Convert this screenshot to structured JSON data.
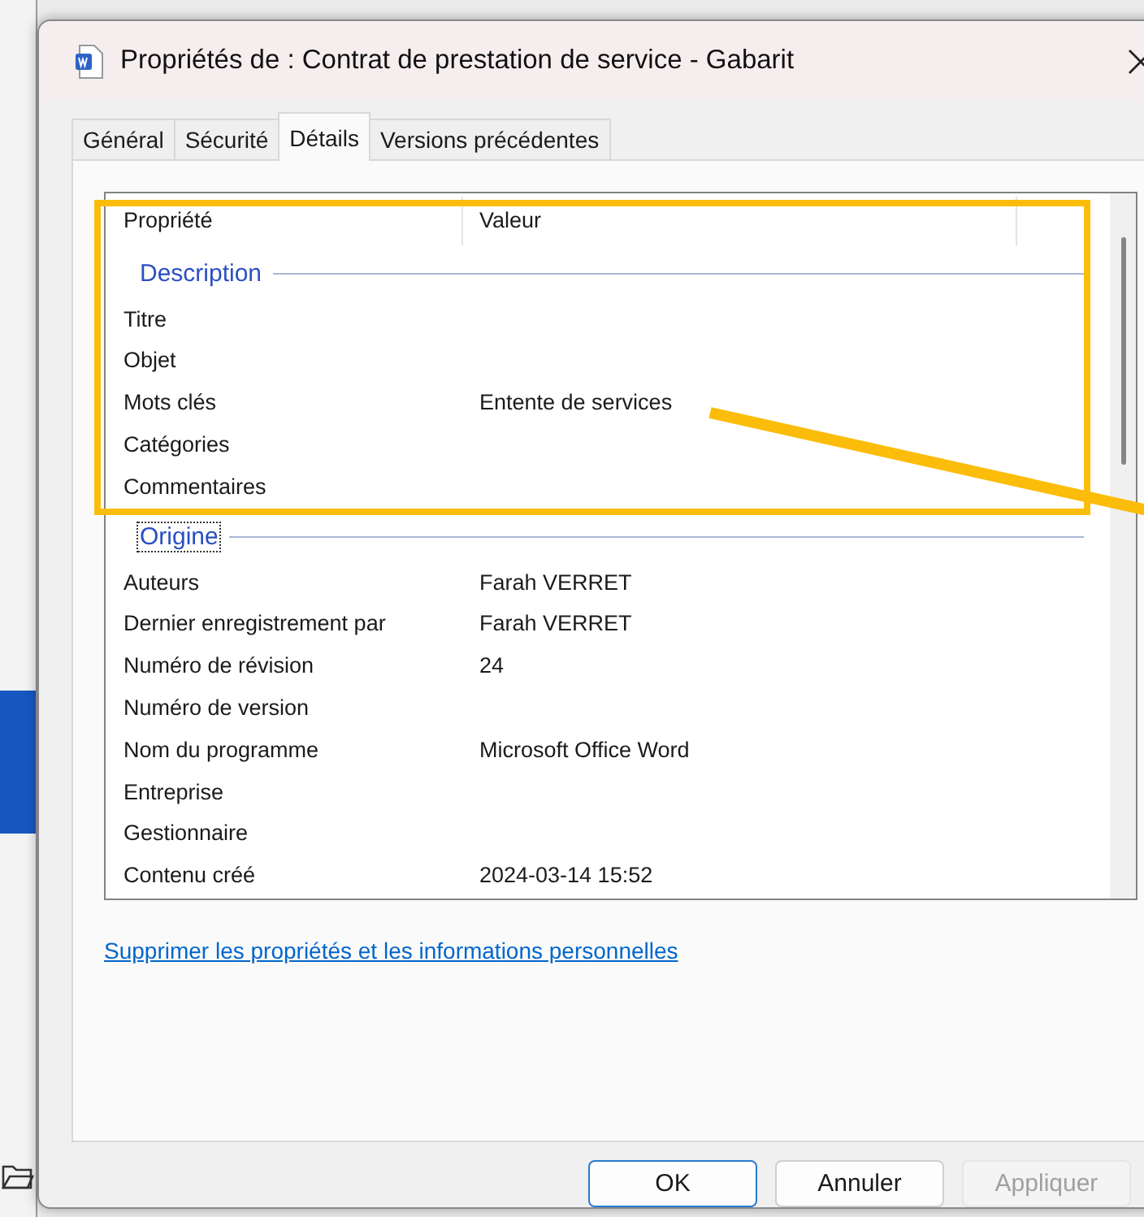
{
  "window": {
    "title": "Propriétés de : Contrat de prestation de service - Gabarit"
  },
  "tabs": [
    {
      "label": "Général",
      "selected": false
    },
    {
      "label": "Sécurité",
      "selected": false
    },
    {
      "label": "Détails",
      "selected": true
    },
    {
      "label": "Versions précédentes",
      "selected": false
    }
  ],
  "table": {
    "columns": [
      "Propriété",
      "Valeur"
    ],
    "groups": [
      {
        "title": "Description",
        "focused": false,
        "rows": [
          {
            "property": "Titre",
            "value": ""
          },
          {
            "property": "Objet",
            "value": ""
          },
          {
            "property": "Mots clés",
            "value": "Entente de services"
          },
          {
            "property": "Catégories",
            "value": ""
          },
          {
            "property": "Commentaires",
            "value": ""
          }
        ]
      },
      {
        "title": "Origine",
        "focused": true,
        "rows": [
          {
            "property": "Auteurs",
            "value": "Farah VERRET"
          },
          {
            "property": "Dernier enregistrement par",
            "value": "Farah VERRET"
          },
          {
            "property": "Numéro de révision",
            "value": "24"
          },
          {
            "property": "Numéro de version",
            "value": ""
          },
          {
            "property": "Nom du programme",
            "value": "Microsoft Office Word"
          },
          {
            "property": "Entreprise",
            "value": ""
          },
          {
            "property": "Gestionnaire",
            "value": ""
          },
          {
            "property": "Contenu créé",
            "value": "2024-03-14 15:52"
          }
        ]
      }
    ]
  },
  "link": "Supprimer les propriétés et les informations personnelles",
  "buttons": [
    {
      "label": "OK",
      "default": true,
      "disabled": false
    },
    {
      "label": "Annuler",
      "default": false,
      "disabled": false
    },
    {
      "label": "Appliquer",
      "default": false,
      "disabled": true
    }
  ]
}
